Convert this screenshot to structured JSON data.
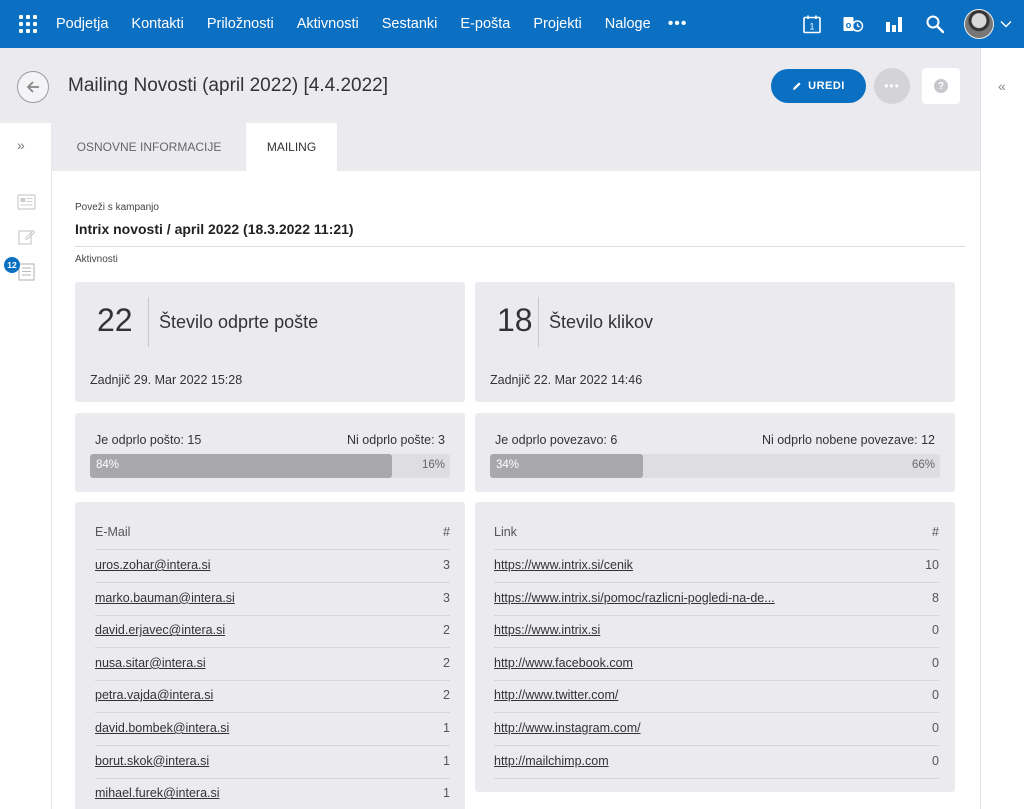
{
  "nav": {
    "items": [
      "Podjetja",
      "Kontakti",
      "Priložnosti",
      "Aktivnosti",
      "Sestanki",
      "E-pošta",
      "Projekti",
      "Naloge"
    ],
    "more": "•••",
    "calendar_day": "1"
  },
  "header": {
    "title": "Mailing Novosti (april 2022) [4.4.2022]",
    "edit_label": "UREDI",
    "more_label": "•••",
    "help_label": "?"
  },
  "sidebar": {
    "badge": "12"
  },
  "tabs": [
    {
      "label": "OSNOVNE INFORMACIJE",
      "active": false
    },
    {
      "label": "MAILING",
      "active": true
    }
  ],
  "campaign": {
    "label": "Poveži s kampanjo",
    "value": "Intrix novosti / april 2022 (18.3.2022 11:21)"
  },
  "activities_label": "Aktivnosti",
  "opens": {
    "count": "22",
    "label": "Število odprte pošte",
    "last": "Zadnjič 29. Mar 2022 15:28",
    "opened_label": "Je odprlo pošto: 15",
    "not_opened_label": "Ni odprlo pošte: 3",
    "opened_pct": "84%",
    "not_opened_pct": "16%",
    "opened_fraction": 0.84
  },
  "clicks": {
    "count": "18",
    "label": "Število klikov",
    "last": "Zadnjič 22. Mar 2022 14:46",
    "opened_label": "Je odprlo povezavo: 6",
    "not_opened_label": "Ni odprlo nobene povezave: 12",
    "opened_pct": "34%",
    "not_opened_pct": "66%",
    "opened_fraction": 0.34
  },
  "emails": {
    "col_email": "E-Mail",
    "col_count": "#",
    "rows": [
      {
        "email": "uros.zohar@intera.si",
        "count": "3"
      },
      {
        "email": "marko.bauman@intera.si",
        "count": "3"
      },
      {
        "email": "david.erjavec@intera.si",
        "count": "2"
      },
      {
        "email": "nusa.sitar@intera.si",
        "count": "2"
      },
      {
        "email": "petra.vajda@intera.si",
        "count": "2"
      },
      {
        "email": "david.bombek@intera.si",
        "count": "1"
      },
      {
        "email": "borut.skok@intera.si",
        "count": "1"
      },
      {
        "email": "mihael.furek@intera.si",
        "count": "1"
      }
    ]
  },
  "links": {
    "col_link": "Link",
    "col_count": "#",
    "rows": [
      {
        "link": "https://www.intrix.si/cenik",
        "count": "10"
      },
      {
        "link": "https://www.intrix.si/pomoc/razlicni-pogledi-na-de...",
        "count": "8"
      },
      {
        "link": "https://www.intrix.si",
        "count": "0"
      },
      {
        "link": "http://www.facebook.com",
        "count": "0"
      },
      {
        "link": "http://www.twitter.com/",
        "count": "0"
      },
      {
        "link": "http://www.instagram.com/",
        "count": "0"
      },
      {
        "link": "http://mailchimp.com",
        "count": "0"
      }
    ]
  },
  "colors": {
    "brand": "#0b6fc2",
    "band": "#ebebef",
    "bar_fill": "#a8a8ac",
    "bar_track": "#dedee2"
  }
}
